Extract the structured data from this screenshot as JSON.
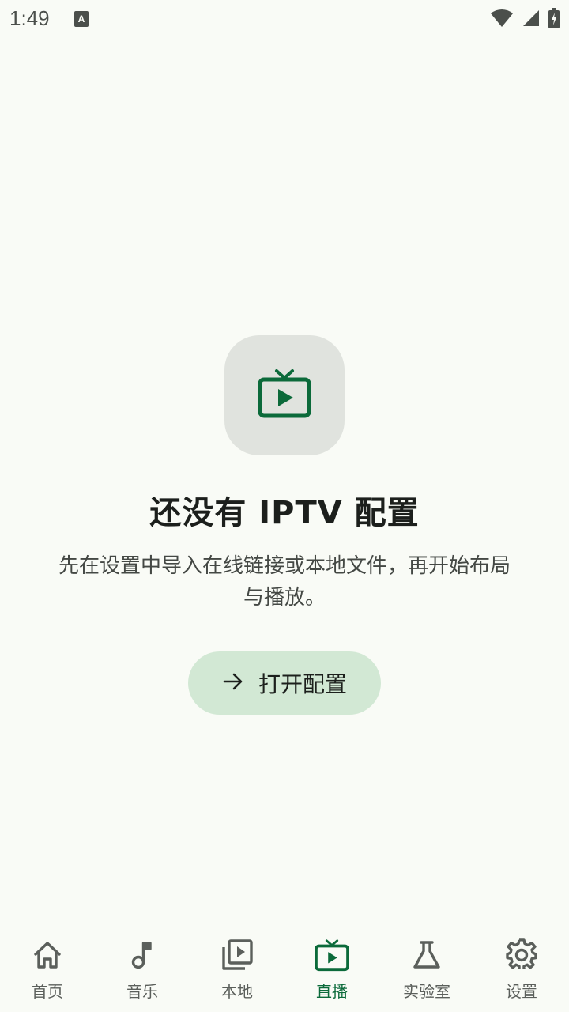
{
  "status_bar": {
    "time": "1:49"
  },
  "empty_state": {
    "icon": "live-tv-icon",
    "title": "还没有 IPTV 配置",
    "description": "先在设置中导入在线链接或本地文件，再开始布局与播放。",
    "button_label": "打开配置",
    "button_icon": "arrow-right-icon"
  },
  "bottom_nav": {
    "items": [
      {
        "label": "首页",
        "icon": "home-icon",
        "active": false
      },
      {
        "label": "音乐",
        "icon": "music-note-icon",
        "active": false
      },
      {
        "label": "本地",
        "icon": "video-library-icon",
        "active": false
      },
      {
        "label": "直播",
        "icon": "live-tv-icon",
        "active": true
      },
      {
        "label": "实验室",
        "icon": "flask-icon",
        "active": false
      },
      {
        "label": "设置",
        "icon": "gear-icon",
        "active": false
      }
    ]
  },
  "colors": {
    "background": "#f9fbf6",
    "accent": "#0b6a3a",
    "button_bg": "#d2e8d4",
    "badge_bg": "#e0e3de"
  }
}
